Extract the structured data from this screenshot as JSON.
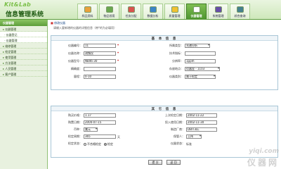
{
  "header": {
    "logo_en": "Kit&Lab",
    "logo_cn": "信息管理系统",
    "top_links": "",
    "nav": [
      {
        "label": "样品资料",
        "icon": "sample-icon",
        "color": "#e9a23b"
      },
      {
        "label": "物品领用",
        "icon": "item-icon",
        "color": "#6aa84f"
      },
      {
        "label": "任务分配",
        "icon": "task-icon",
        "color": "#d9534f"
      },
      {
        "label": "数据分析",
        "icon": "chart-icon",
        "color": "#3d85c6"
      },
      {
        "label": "质量管理",
        "icon": "quality-icon",
        "color": "#f1c232"
      },
      {
        "label": "仪器管理",
        "icon": "instrument-icon",
        "color": "#ffffff"
      },
      {
        "label": "系统管理",
        "icon": "settings-icon",
        "color": "#674ea7"
      },
      {
        "label": "综合查询",
        "icon": "query-icon",
        "color": "#45818e"
      }
    ],
    "active_nav": 5
  },
  "sidebar": {
    "title": "仪器管理",
    "items": [
      {
        "label": "仪器管理",
        "sub": false
      },
      {
        "label": "仪器登记",
        "sub": true
      },
      {
        "label": "仪器管理",
        "sub": true
      },
      {
        "label": "维修管理",
        "sub": false
      },
      {
        "label": "检定管理",
        "sub": false
      },
      {
        "label": "使用管理",
        "sub": false
      },
      {
        "label": "方法管理",
        "sub": false
      },
      {
        "label": "人员管理",
        "sub": false
      },
      {
        "label": "客户管理",
        "sub": false
      }
    ]
  },
  "main": {
    "crumb_prefix": "■",
    "crumb": "修改仪器",
    "hint": "请输入要新增的仪器的详细信息（带*的为必填项）",
    "basic": {
      "title": "基 本 信 息",
      "instrument_code_label": "仪器编号：",
      "instrument_code": "11",
      "instrument_name_label": "仪器名称：",
      "instrument_name": "测频仪",
      "model_label": "仪器型号：",
      "model": "NB46-30",
      "precision_label": "精确度：",
      "precision": "",
      "range_label": "量程：",
      "range": "0-10",
      "class_label": "所属类型：",
      "class": "光谱分析",
      "tech_label": "技术指标：",
      "tech": "",
      "resolution_label": "分辨率：",
      "resolution": "1ppm",
      "location_label": "存放地点：",
      "location": "仪器室 - 1103",
      "category_label": "仪器类别：",
      "category": "属于检定"
    },
    "other": {
      "title": "其 它 信 息",
      "price_label": "购买价格：",
      "price": "1.17",
      "buy_date_label": "购置日期：",
      "buy_date": "2004-07-15",
      "currency_label": "币种：",
      "currency": "美元",
      "period_label": "检定周期：",
      "period": "365",
      "period_unit": "天",
      "status_label": "检定状态：",
      "status_opts": [
        "不合格检定",
        "检定"
      ],
      "status_selected": 1,
      "last_label": "上次检定日期：",
      "last": "2002-11-22",
      "start_label": "投入使用日期：",
      "start": "2002-11-30",
      "maker_label": "制造厂商：",
      "maker": "DBIT3LL",
      "keeper_label": "保管人：",
      "keeper": "王伟",
      "state_label": "仪器状态：",
      "state": "标准"
    },
    "buttons": {
      "submit": "提 交",
      "back": "返 回"
    }
  },
  "watermark": {
    "line1": "yiqi.com",
    "line2": "仪器网"
  }
}
